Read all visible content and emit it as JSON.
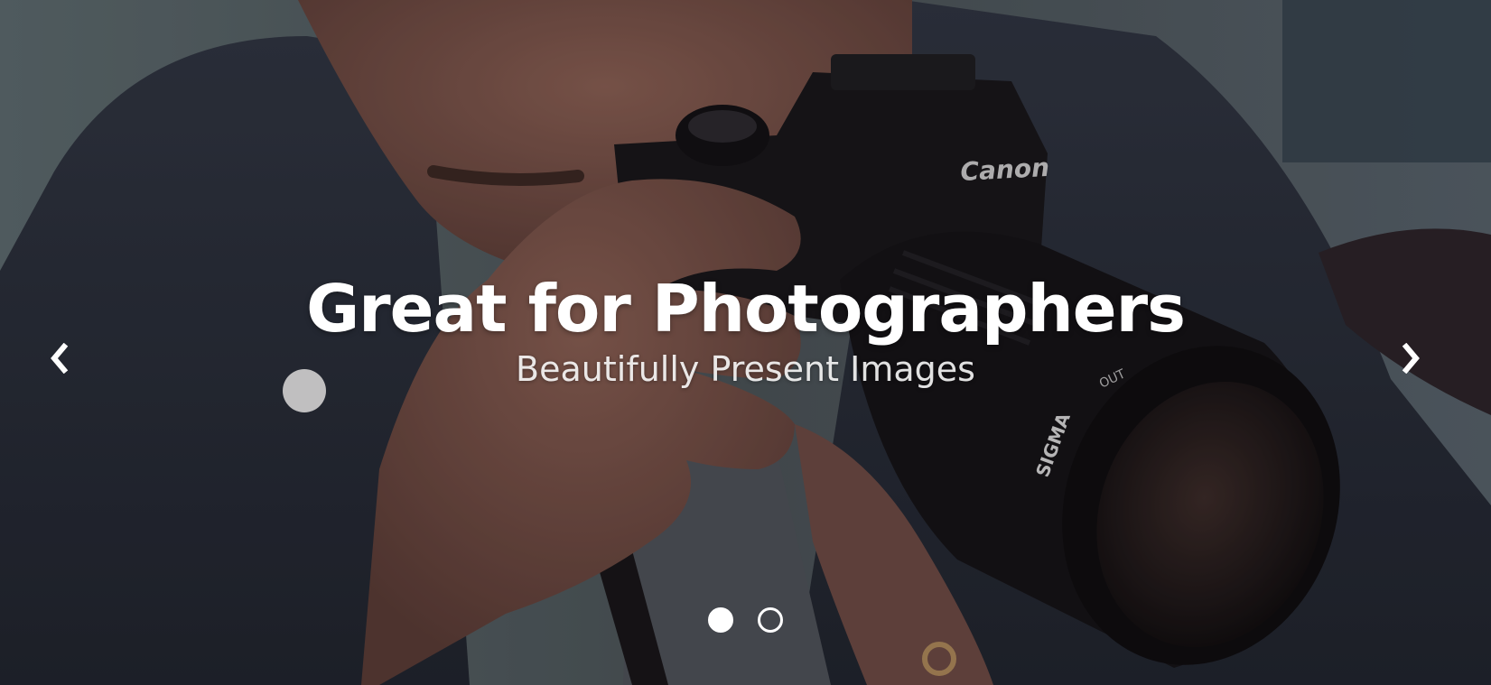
{
  "slider": {
    "active_index": 0,
    "slides": [
      {
        "title": "Great for Photographers",
        "subtitle": "Beautifully Present Images",
        "background": "photographer-with-canon-camera"
      }
    ],
    "camera_brand": "Canon",
    "lens_brand": "SIGMA",
    "lens_marking": "OUT",
    "prev_icon": "chevron-left-icon",
    "next_icon": "chevron-right-icon",
    "pager_dots": [
      {
        "state": "active"
      },
      {
        "state": "inactive"
      }
    ],
    "colors": {
      "text": "#ffffff",
      "overlay": "rgba(20,18,24,0.18)"
    }
  }
}
